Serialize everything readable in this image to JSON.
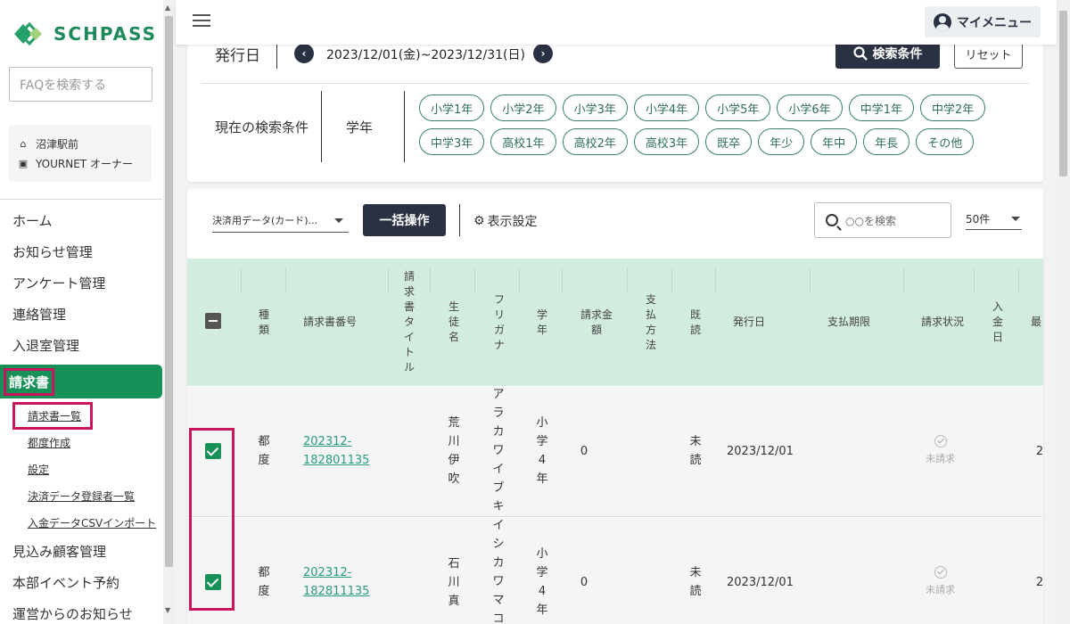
{
  "brand": {
    "name": "SCHPASS",
    "color": "#1e8a5a"
  },
  "sidebar": {
    "faq_placeholder": "FAQを検索する",
    "school": {
      "name": "沼津駅前",
      "user": "YOURNET オーナー"
    },
    "nav": [
      {
        "label": "ホーム"
      },
      {
        "label": "お知らせ管理"
      },
      {
        "label": "アンケート管理"
      },
      {
        "label": "連絡管理"
      },
      {
        "label": "入退室管理"
      }
    ],
    "active_label": "請求書",
    "sub_items": [
      {
        "label": "請求書一覧"
      },
      {
        "label": "都度作成"
      },
      {
        "label": "設定"
      },
      {
        "label": "決済データ登録者一覧"
      },
      {
        "label": "入金データCSVインポート"
      }
    ],
    "nav_after": [
      {
        "label": "見込み顧客管理"
      },
      {
        "label": "本部イベント予約"
      },
      {
        "label": "運営からのお知らせ"
      }
    ]
  },
  "topbar": {
    "my_menu": "マイメニュー"
  },
  "filter": {
    "date_label": "発行日",
    "date_range": "2023/12/01(金)~2023/12/31(日)",
    "search_button": "検索条件",
    "reset_button": "リセット",
    "current_label": "現在の検索条件",
    "grade_label": "学年",
    "chips": [
      "小学1年",
      "小学2年",
      "小学3年",
      "小学4年",
      "小学5年",
      "小学6年",
      "中学1年",
      "中学2年",
      "中学3年",
      "高校1年",
      "高校2年",
      "高校3年",
      "既卒",
      "年少",
      "年中",
      "年長",
      "その他"
    ]
  },
  "toolbar": {
    "select_value": "決済用データ(カード)...",
    "bulk_button": "一括操作",
    "display_settings": "表示設定",
    "search_placeholder": "○○を検索",
    "per_page": "50件"
  },
  "table": {
    "headers": [
      "種類",
      "請求書番号",
      "請求書タイトル",
      "生徒名",
      "フリガナ",
      "学年",
      "請求金額",
      "支払方法",
      "既読",
      "発行日",
      "支払期限",
      "請求状況",
      "入金日",
      "最"
    ],
    "rows": [
      {
        "type": "都度",
        "invoice_no": "202312-182801135",
        "student": "荒川伊吹",
        "furigana": "アラカワイブキ",
        "grade": "小学4年",
        "amount": "0",
        "read": "未読",
        "issued": "2023/12/01",
        "status": "未請求",
        "extra": "2"
      },
      {
        "type": "都度",
        "invoice_no": "202312-182811135",
        "student": "石川真",
        "furigana": "イシカワマコ",
        "grade": "小学4年",
        "amount": "0",
        "read": "未読",
        "issued": "2023/12/01",
        "status": "未請求",
        "extra": "2"
      }
    ]
  },
  "colors": {
    "accent": "#189158",
    "highlight": "#c8165c",
    "dark_button": "#2a3142",
    "table_header": "#d2ecdf"
  }
}
